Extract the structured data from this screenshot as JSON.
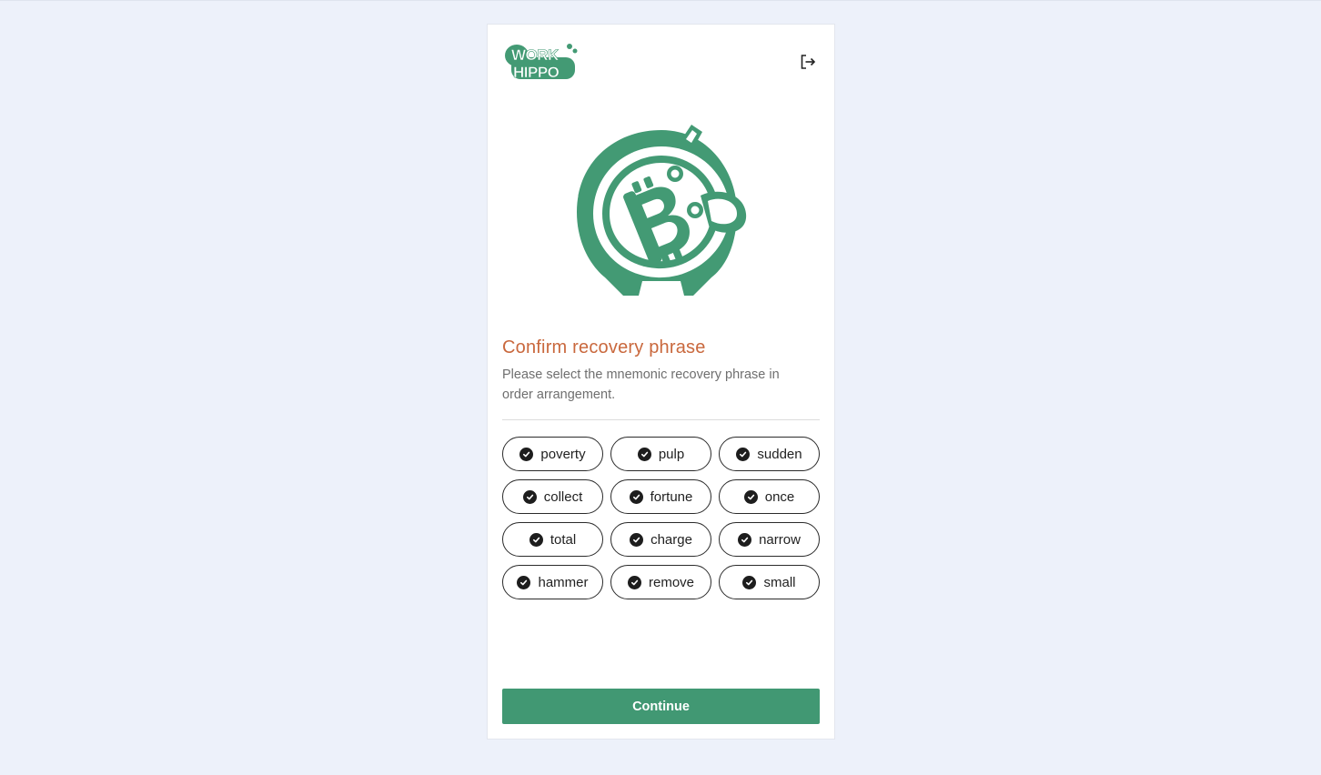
{
  "brand": {
    "logo_top": "WORK",
    "logo_bottom": "HIPPO",
    "color": "#439a74"
  },
  "header": {
    "logout_icon": "logout-icon"
  },
  "confirm": {
    "title": "Confirm recovery phrase",
    "subtitle": "Please select the mnemonic recovery phrase in order arrangement.",
    "title_color": "#c9683d"
  },
  "words": [
    {
      "label": "poverty",
      "selected": true
    },
    {
      "label": "pulp",
      "selected": true
    },
    {
      "label": "sudden",
      "selected": true
    },
    {
      "label": "collect",
      "selected": true
    },
    {
      "label": "fortune",
      "selected": true
    },
    {
      "label": "once",
      "selected": true
    },
    {
      "label": "total",
      "selected": true
    },
    {
      "label": "charge",
      "selected": true
    },
    {
      "label": "narrow",
      "selected": true
    },
    {
      "label": "hammer",
      "selected": true
    },
    {
      "label": "remove",
      "selected": true
    },
    {
      "label": "small",
      "selected": true
    }
  ],
  "actions": {
    "continue_label": "Continue",
    "continue_color": "#419873"
  }
}
